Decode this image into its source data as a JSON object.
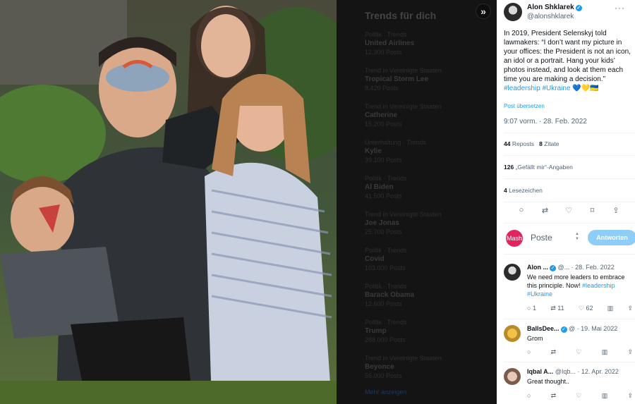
{
  "trends_panel": {
    "title": "Trends für dich",
    "items": [
      {
        "context": "Politik · Trends",
        "name": "United Airlines",
        "count": "12.300 Posts"
      },
      {
        "context": "Trend in Vereinigte Staaten",
        "name": "Tropical Storm Lee",
        "count": "8.420 Posts"
      },
      {
        "context": "Trend in Vereinigte Staaten",
        "name": "Catherine",
        "count": "15.200 Posts"
      },
      {
        "context": "Unterhaltung · Trends",
        "name": "Kylie",
        "count": "39.100 Posts"
      },
      {
        "context": "Politik · Trends",
        "name": "Al Biden",
        "count": "41.500 Posts"
      },
      {
        "context": "Trend in Vereinigte Staaten",
        "name": "Joe Jonas",
        "count": "25.700 Posts"
      },
      {
        "context": "Politik · Trends",
        "name": "Covid",
        "count": "103.000 Posts"
      },
      {
        "context": "Politik · Trends",
        "name": "Barack Obama",
        "count": "12.600 Posts"
      },
      {
        "context": "Politik · Trends",
        "name": "Trump",
        "count": "288.000 Posts"
      },
      {
        "context": "Trend in Vereinigte Staaten",
        "name": "Beyonce",
        "count": "56.000 Posts"
      }
    ],
    "show_more": "Mehr anzeigen"
  },
  "tweet": {
    "author_name": "Alon Shklarek",
    "author_handle": "@alonshklarek",
    "more_icon": "more-dots-icon",
    "text_main": "In 2019, President Selenskyj told lawmakers: “I don’t want my picture in your offices: the President is not an icon, an idol or a portrait. Hang your kids’ photos instead, and look at them each time you are making a decision.” ",
    "hashtags": "#leadership #Ukraine",
    "emojis": "💙💛🇺🇦",
    "translate": "Post übersetzen",
    "timestamp": "9:07 vorm. · 28. Feb. 2022",
    "reposts_count": "44",
    "reposts_label": "Reposts",
    "quotes_count": "8",
    "quotes_label": "Zitate",
    "likes_count": "126",
    "likes_label": "„Gefällt mir“-Angaben",
    "bookmarks_count": "4",
    "bookmarks_label": "Lesezeichen"
  },
  "compose": {
    "placeholder": "Poste",
    "reply_button": "Antworten",
    "avatar_text": "Mash"
  },
  "replies": [
    {
      "name": "Alon ...",
      "meta": "@... · 28. Feb. 2022",
      "text": "We need more leaders to embrace this principle. Now! ",
      "tags": "#leadership #Ukraine",
      "replies": "1",
      "reposts": "11",
      "likes": "62"
    },
    {
      "name": "BallsDee...",
      "meta": "@ · 19. Mai 2022",
      "text": "Grom",
      "tags": "",
      "replies": "",
      "reposts": "",
      "likes": ""
    },
    {
      "name": "Iqbal A...",
      "meta": "@Iqb... · 12. Apr. 2022",
      "text": "Great thought..",
      "tags": "",
      "replies": "",
      "reposts": "",
      "likes": ""
    }
  ],
  "icons": {
    "expand": "»",
    "reply": "○",
    "repost": "⇄",
    "like": "♡",
    "bookmark": "⌑",
    "share": "⇪",
    "stats": "▥"
  }
}
